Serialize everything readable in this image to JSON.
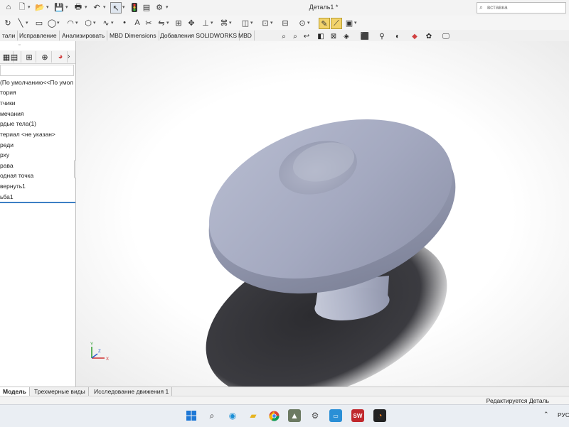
{
  "window": {
    "title": "Деталь1 *"
  },
  "search": {
    "placeholder": "вставка"
  },
  "command_tabs": [
    {
      "label": "тали"
    },
    {
      "label": "Исправление"
    },
    {
      "label": "Анализировать"
    },
    {
      "label": "MBD Dimensions"
    },
    {
      "label": "Добавления SOLIDWORKS"
    },
    {
      "label": "MBD"
    }
  ],
  "feature_tree": {
    "items": [
      {
        "label": "(По умолчанию<<По умол"
      },
      {
        "label": "тория"
      },
      {
        "label": "тчики"
      },
      {
        "label": "мечания"
      },
      {
        "label": "рдые тела(1)"
      },
      {
        "label": "териал <не указан>"
      },
      {
        "label": "реди"
      },
      {
        "label": "рху"
      },
      {
        "label": "рава"
      },
      {
        "label": "одная точка"
      },
      {
        "label": "вернуть1"
      },
      {
        "label": "ьба1"
      }
    ]
  },
  "model_tabs": [
    {
      "label": "Модель",
      "active": true
    },
    {
      "label": "Трехмерные виды"
    },
    {
      "label": "Исследование движения 1"
    }
  ],
  "status": {
    "text": "Редактируется Деталь"
  },
  "taskbar": {
    "language": "РУС"
  },
  "colors": {
    "model_body": "#a8adc4",
    "shadow": "#3a3a3e",
    "accent": "#3c7fc4"
  },
  "icons": {
    "title_bar": [
      "home-icon",
      "new-document-icon",
      "open-folder-icon",
      "save-icon",
      "print-icon",
      "undo-icon",
      "select-arrow-icon",
      "traffic-light-icon",
      "file-properties-icon",
      "options-gear-icon"
    ],
    "view_toolbar": [
      "zoom-to-fit-icon",
      "zoom-area-icon",
      "previous-view-icon",
      "section-view-icon",
      "view-orientation-icon",
      "display-style-icon",
      "hide-show-icon",
      "edit-appearance-icon",
      "apply-scene-icon",
      "view-settings-icon"
    ]
  }
}
